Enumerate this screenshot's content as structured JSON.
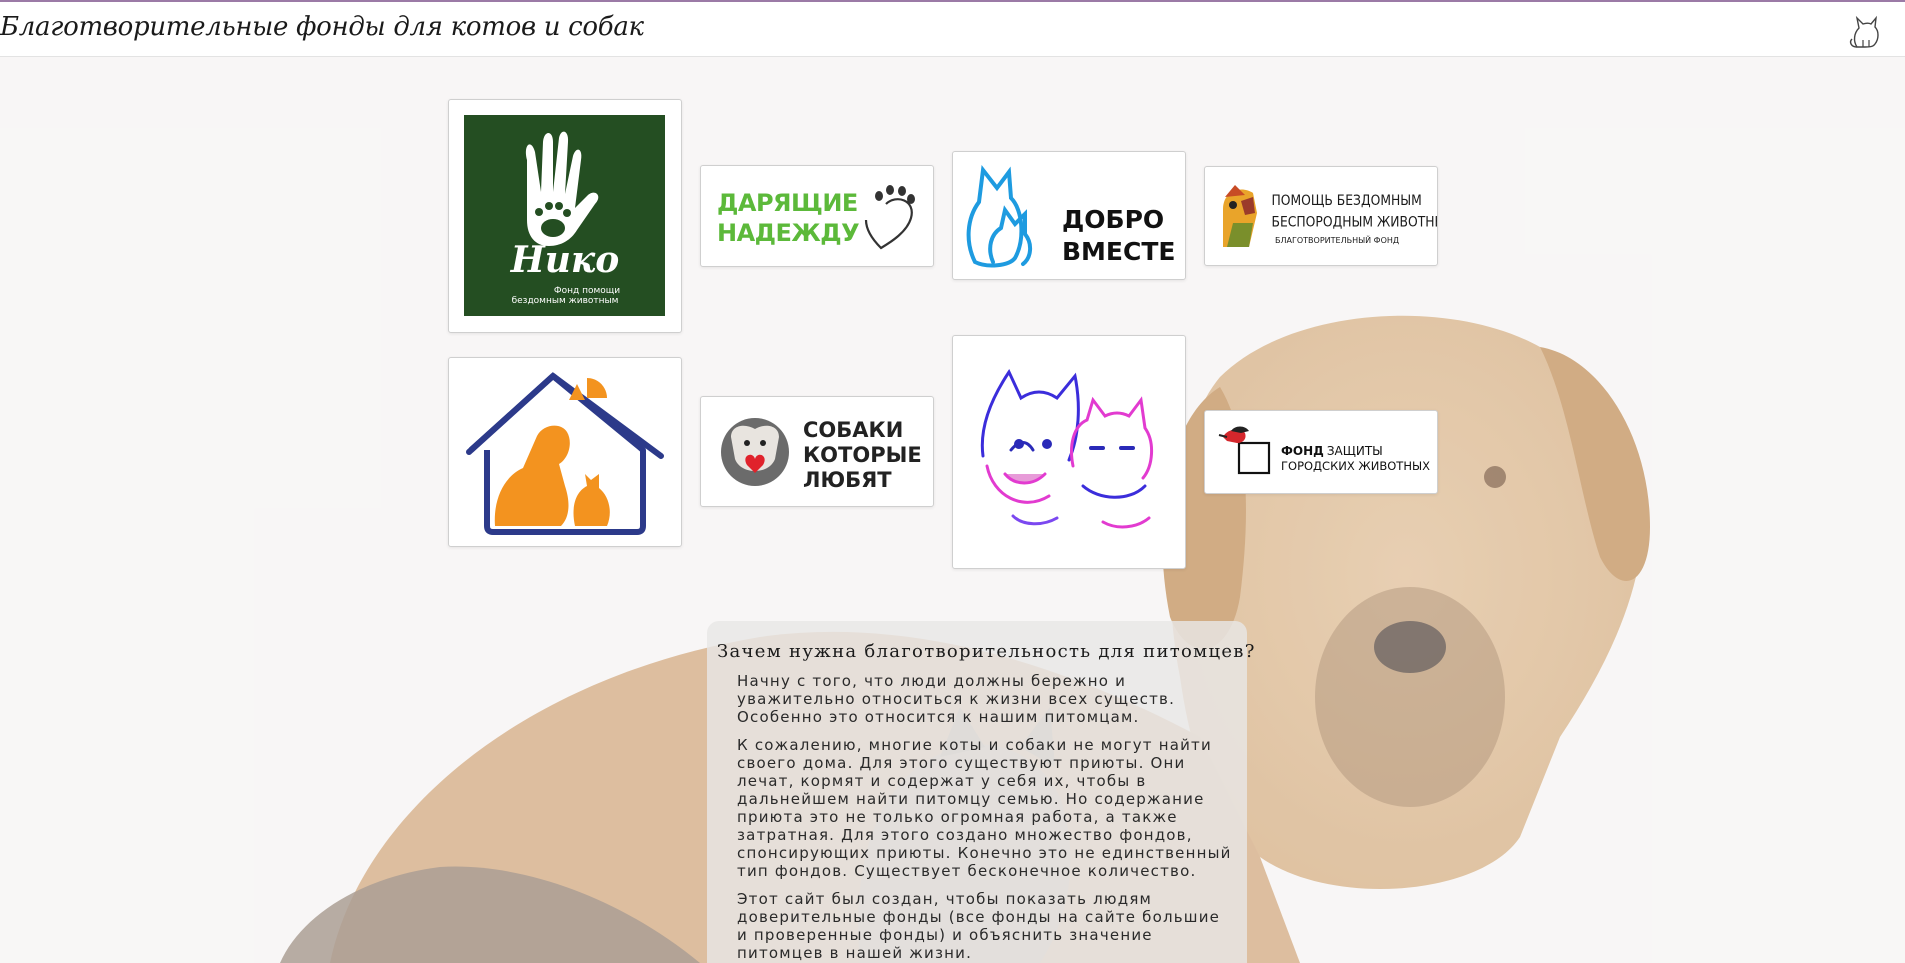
{
  "header": {
    "title": "Благотворительные фонды для котов и собак",
    "logo_icon": "cat-outline-icon"
  },
  "foundations": [
    {
      "id": "niko",
      "line1": "Нико",
      "line2": "Фонд помощи",
      "line3": "бездомным животным",
      "colors": {
        "bg": "#244e22",
        "fg": "#ffffff"
      }
    },
    {
      "id": "daryashchie",
      "line1": "ДАРЯЩИЕ",
      "line2": "НАДЕЖДУ",
      "colors": {
        "fg": "#5cb93a"
      }
    },
    {
      "id": "dobro",
      "line1": "ДОБРО",
      "line2": "ВМЕСТЕ",
      "colors": {
        "icon": "#1e9be0",
        "fg": "#111111"
      }
    },
    {
      "id": "pomoshch",
      "line1": "ПОМОЩЬ БЕЗДОМНЫМ",
      "line2": "БЕСПОРОДНЫМ ЖИВОТНЫМ",
      "line3": "БЛАГОТВОРИТЕЛЬНЫЙ ФОНД",
      "colors": {
        "fg": "#1a1a1a"
      }
    },
    {
      "id": "house",
      "icon": "house-dog-cat-icon",
      "colors": {
        "frame": "#2c3a8a",
        "animals": "#f3931f"
      }
    },
    {
      "id": "sobaki",
      "line1": "СОБАКИ",
      "line2": "КОТОРЫЕ",
      "line3": "ЛЮБЯТ",
      "colors": {
        "fg": "#222222",
        "heart": "#e0222b"
      }
    },
    {
      "id": "dogcat",
      "icon": "dog-and-cat-drawing-icon",
      "colors": {
        "a": "#3b2ddb",
        "b": "#e23bd0"
      }
    },
    {
      "id": "zashchita",
      "line1": "ФОНД",
      "line1b": "ЗАЩИТЫ",
      "line2": "ГОРОДСКИХ ЖИВОТНЫХ",
      "colors": {
        "bird": "#d4272c",
        "fg": "#111111"
      }
    }
  ],
  "info": {
    "heading": "Зачем нужна благотворительность для питомцев?",
    "p1_lines": [
      "Начну с того, что люди должны бережно и",
      "уважительно относиться к жизни всех существ.",
      "Особенно это относится к нашим питомцам."
    ],
    "p2_lines": [
      "К сожалению, многие коты и собаки не могут найти",
      "своего дома. Для этого существуют приюты. Они",
      "лечат, кормят и содержат у себя их, чтобы в",
      "дальнейшем найти питомцу семью. Но содержание",
      "приюта это не только огромная работа, а также",
      "затратная. Для этого создано множество фондов,",
      "спонсирующих приюты. Конечно это не единственный",
      "тип фондов. Существует бесконечное количество."
    ],
    "p3_lines": [
      "Этот сайт был создан, чтобы показать людям",
      "доверительные фонды (все фонды на сайте большие",
      "и проверенные фонды) и объяснить значение",
      "питомцев в нашей жизни."
    ]
  }
}
